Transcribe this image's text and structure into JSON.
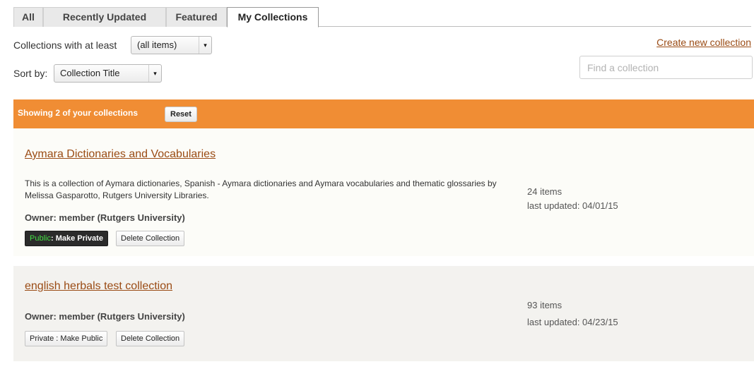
{
  "tabs": [
    {
      "label": "All"
    },
    {
      "label": "Recently Updated"
    },
    {
      "label": "Featured"
    },
    {
      "label": "My Collections",
      "active": true
    }
  ],
  "filters": {
    "min_items_label": "Collections with at least",
    "min_items_value": "(all items)",
    "sort_label": "Sort by:",
    "sort_value": "Collection Title"
  },
  "create_link": "Create new collection",
  "search": {
    "placeholder": "Find a collection",
    "value": ""
  },
  "results_bar": {
    "text": "Showing 2 of your collections",
    "reset_label": "Reset",
    "color": "#f08d34"
  },
  "collections": [
    {
      "title": "Aymara Dictionaries and Vocabularies",
      "description": "This is a collection of Aymara dictionaries, Spanish - Aymara dictionaries and Aymara vocabularies and thematic glossaries by Melissa Gasparotto, Rutgers University Libraries.",
      "owner": "Owner: member (Rutgers University)",
      "items": "24 items",
      "last_updated": "last updated: 04/01/15",
      "visibility_state": "Public",
      "visibility_action": ": Make Private",
      "delete_label": "Delete Collection"
    },
    {
      "title": "english herbals test collection",
      "description": "",
      "owner": "Owner: member (Rutgers University)",
      "items": "93 items",
      "last_updated": "last updated: 04/23/15",
      "visibility_button": "Private : Make Public",
      "delete_label": "Delete Collection"
    }
  ]
}
